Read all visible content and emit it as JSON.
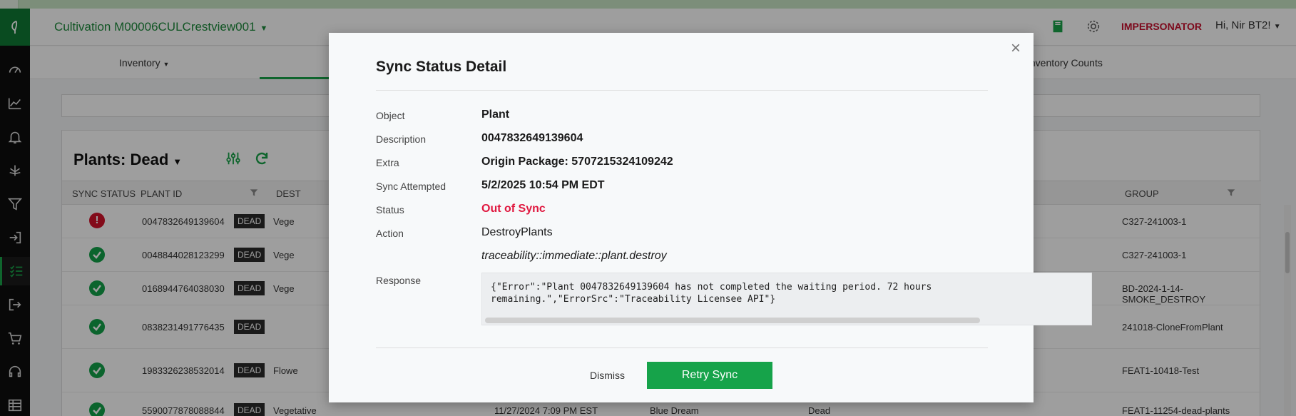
{
  "app": {
    "facility": "Cultivation M00006CULCrestview001",
    "impersonator": "IMPERSONATOR",
    "greeting": "Hi, Nir BT2!"
  },
  "subnav": {
    "inventory": "Inventory",
    "inventory_counts": "Inventory Counts"
  },
  "panel": {
    "title": "Plants: Dead",
    "columns": {
      "sync_status": "SYNC STATUS",
      "plant_id": "PLANT ID",
      "destroy": "DEST",
      "group": "GROUP"
    },
    "rows": [
      {
        "status": "error",
        "plant_id": "0047832649139604",
        "badge": "DEAD",
        "stage": "Vege",
        "date": "",
        "strain": "",
        "state": "",
        "group": "C327-241003-1"
      },
      {
        "status": "ok",
        "plant_id": "0048844028123299",
        "badge": "DEAD",
        "stage": "Vege",
        "date": "",
        "strain": "",
        "state": "",
        "group": "C327-241003-1"
      },
      {
        "status": "ok",
        "plant_id": "0168944764038030",
        "badge": "DEAD",
        "stage": "Vege",
        "date": "",
        "strain": "",
        "state": "",
        "group": "BD-2024-1-14-SMOKE_DESTROY"
      },
      {
        "status": "ok",
        "plant_id": "0838231491776435",
        "badge": "DEAD",
        "stage": "",
        "date": "",
        "strain": "",
        "state": "",
        "group": "241018-CloneFromPlant"
      },
      {
        "status": "ok",
        "plant_id": "1983326238532014",
        "badge": "DEAD",
        "stage": "Flowe",
        "date": "",
        "strain": "",
        "state": "",
        "group": "FEAT1-10418-Test"
      },
      {
        "status": "ok",
        "plant_id": "5590077878088844",
        "badge": "DEAD",
        "stage": "Vegetative",
        "date": "11/27/2024 7:09 PM EST",
        "strain": "Blue Dream",
        "state": "Dead",
        "group": "FEAT1-11254-dead-plants"
      }
    ]
  },
  "modal": {
    "title": "Sync Status Detail",
    "labels": {
      "object": "Object",
      "description": "Description",
      "extra": "Extra",
      "sync_attempted": "Sync Attempted",
      "status": "Status",
      "action": "Action",
      "response": "Response"
    },
    "values": {
      "object": "Plant",
      "description": "0047832649139604",
      "extra": "Origin Package: 5707215324109242",
      "sync_attempted": "5/2/2025 10:54 PM EDT",
      "status": "Out of Sync",
      "action": "DestroyPlants",
      "action_detail": "traceability::immediate::plant.destroy",
      "response": "{\"Error\":\"Plant 0047832649139604 has not completed the waiting period. 72 hours remaining.\",\"ErrorSrc\":\"Traceability Licensee API\"}"
    },
    "dismiss_label": "Dismiss",
    "retry_label": "Retry Sync",
    "close_glyph": "×"
  },
  "colors": {
    "brand_green": "#16a34a",
    "error_red": "#e0183f",
    "impersonator_red": "#c8102e"
  }
}
